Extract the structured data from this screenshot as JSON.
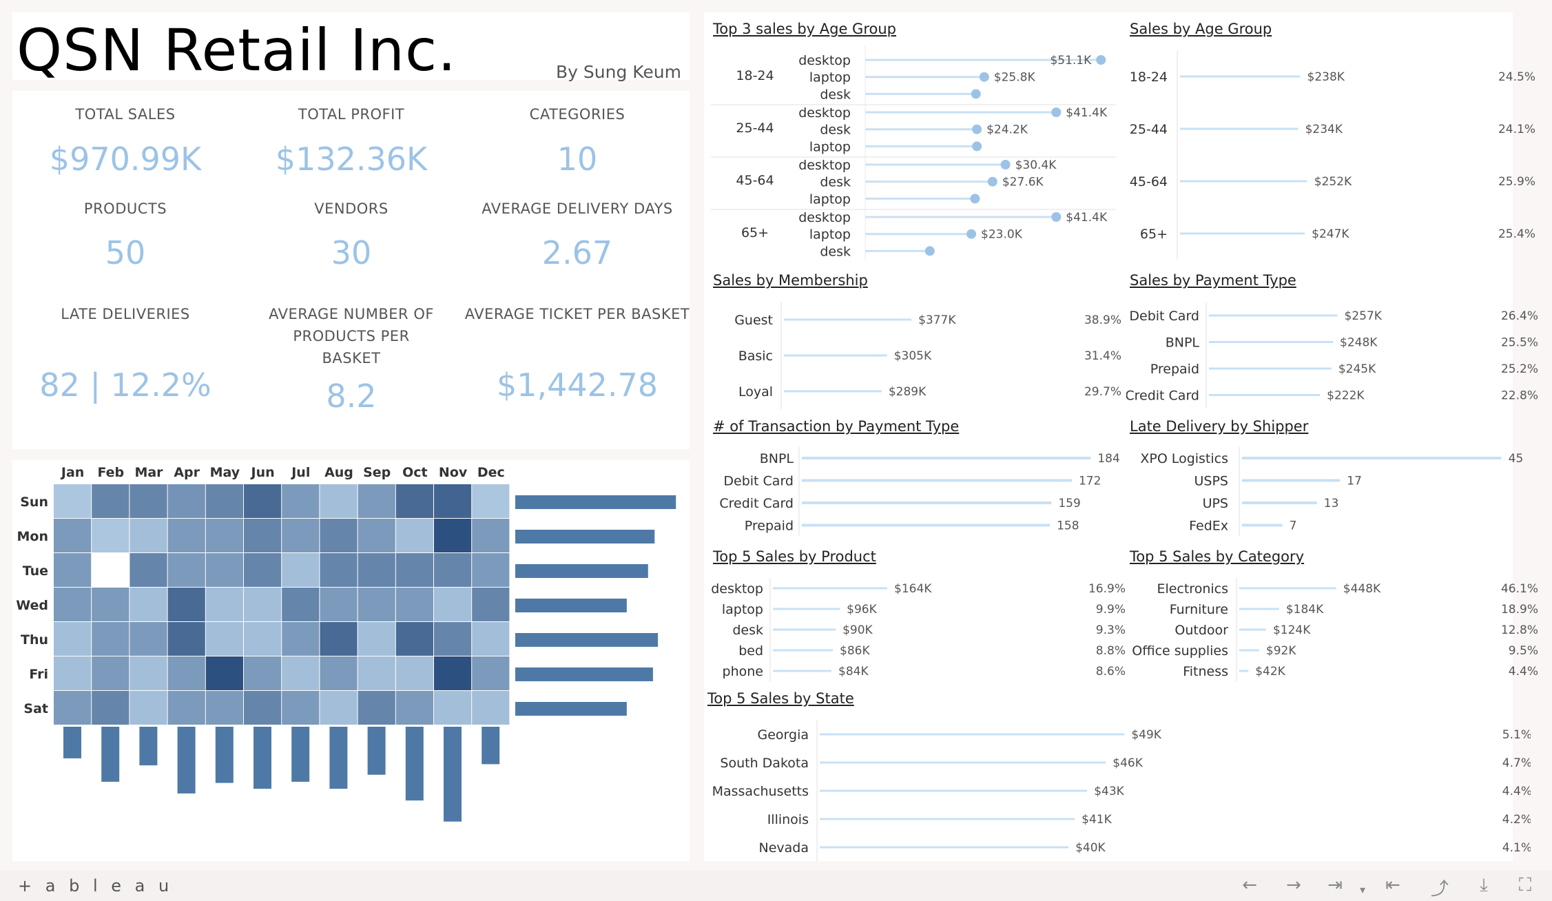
{
  "header": {
    "title": "QSN Retail Inc.",
    "author": "By Sung Keum"
  },
  "kpis": [
    {
      "label": "TOTAL SALES",
      "value": "$970.99K"
    },
    {
      "label": "TOTAL PROFIT",
      "value": "$132.36K"
    },
    {
      "label": "CATEGORIES",
      "value": "10"
    },
    {
      "label": "PRODUCTS",
      "value": "50"
    },
    {
      "label": "VENDORS",
      "value": "30"
    },
    {
      "label": "AVERAGE DELIVERY DAYS",
      "value": "2.67"
    },
    {
      "label": "LATE DELIVERIES",
      "value": "82 | 12.2%"
    },
    {
      "label": "AVERAGE NUMBER OF PRODUCTS PER BASKET",
      "value": "8.2"
    },
    {
      "label": "AVERAGE TICKET PER BASKET",
      "value": "$1,442.78"
    }
  ],
  "colors": {
    "accent": "#9cc3e6",
    "bar_dark": "#4e79a7",
    "bar_light": "#c8e0f4",
    "dot": "#9cc3e6"
  },
  "chart_data": [
    {
      "id": "heatmap",
      "type": "heatmap",
      "months": [
        "Jan",
        "Feb",
        "Mar",
        "Apr",
        "May",
        "Jun",
        "Jul",
        "Aug",
        "Sep",
        "Oct",
        "Nov",
        "Dec"
      ],
      "days": [
        "Sun",
        "Mon",
        "Tue",
        "Wed",
        "Thu",
        "Fri",
        "Sat"
      ],
      "intensity": [
        [
          0.15,
          0.6,
          0.6,
          0.5,
          0.6,
          0.8,
          0.45,
          0.2,
          0.45,
          0.8,
          0.85,
          0.15
        ],
        [
          0.45,
          0.15,
          0.2,
          0.45,
          0.45,
          0.6,
          0.45,
          0.6,
          0.45,
          0.2,
          1.0,
          0.45
        ],
        [
          0.45,
          0.0,
          0.6,
          0.45,
          0.45,
          0.6,
          0.2,
          0.6,
          0.6,
          0.6,
          0.6,
          0.45
        ],
        [
          0.45,
          0.45,
          0.2,
          0.8,
          0.2,
          0.2,
          0.6,
          0.45,
          0.45,
          0.45,
          0.2,
          0.6
        ],
        [
          0.2,
          0.45,
          0.45,
          0.8,
          0.2,
          0.2,
          0.45,
          0.8,
          0.2,
          0.8,
          0.6,
          0.2
        ],
        [
          0.2,
          0.45,
          0.2,
          0.45,
          1.0,
          0.45,
          0.2,
          0.45,
          0.2,
          0.2,
          1.0,
          0.45
        ],
        [
          0.45,
          0.6,
          0.2,
          0.45,
          0.45,
          0.6,
          0.45,
          0.2,
          0.6,
          0.45,
          0.2,
          0.2
        ]
      ],
      "day_totals": [
        0.98,
        0.85,
        0.81,
        0.68,
        0.87,
        0.84,
        0.68
      ],
      "month_totals": [
        0.27,
        0.47,
        0.33,
        0.57,
        0.48,
        0.53,
        0.47,
        0.53,
        0.41,
        0.63,
        0.81,
        0.32
      ]
    },
    {
      "id": "top3-age",
      "type": "scatter",
      "title": "Top 3 sales by Age Group",
      "groups": [
        {
          "name": "18-24",
          "items": [
            {
              "product": "desktop",
              "value": 51.1,
              "label": "$51.1K"
            },
            {
              "product": "laptop",
              "value": 25.8,
              "label": "$25.8K"
            },
            {
              "product": "desk",
              "value": 24.0,
              "label": ""
            }
          ]
        },
        {
          "name": "25-44",
          "items": [
            {
              "product": "desktop",
              "value": 41.4,
              "label": "$41.4K"
            },
            {
              "product": "desk",
              "value": 24.2,
              "label": "$24.2K"
            },
            {
              "product": "laptop",
              "value": 24.2,
              "label": ""
            }
          ]
        },
        {
          "name": "45-64",
          "items": [
            {
              "product": "desktop",
              "value": 30.4,
              "label": "$30.4K"
            },
            {
              "product": "desk",
              "value": 27.6,
              "label": "$27.6K"
            },
            {
              "product": "laptop",
              "value": 23.8,
              "label": ""
            }
          ]
        },
        {
          "name": "65+",
          "items": [
            {
              "product": "desktop",
              "value": 41.4,
              "label": "$41.4K"
            },
            {
              "product": "laptop",
              "value": 23.0,
              "label": "$23.0K"
            },
            {
              "product": "desk",
              "value": 14.0,
              "label": ""
            }
          ]
        }
      ],
      "xlim": [
        0,
        53
      ]
    },
    {
      "id": "age-group",
      "type": "bar",
      "title": "Sales by Age Group",
      "categories": [
        "18-24",
        "25-44",
        "45-64",
        "65+"
      ],
      "values": [
        238,
        234,
        252,
        247
      ],
      "labels": [
        "$238K",
        "$234K",
        "$252K",
        "$247K"
      ],
      "pcts": [
        "24.5%",
        "24.1%",
        "25.9%",
        "25.4%"
      ],
      "xlim": [
        0,
        750
      ]
    },
    {
      "id": "membership",
      "type": "bar",
      "title": "Sales by Membership",
      "categories": [
        "Guest",
        "Basic",
        "Loyal"
      ],
      "values": [
        377,
        305,
        289
      ],
      "labels": [
        "$377K",
        "$305K",
        "$289K"
      ],
      "pcts": [
        "38.9%",
        "31.4%",
        "29.7%"
      ],
      "xlim": [
        0,
        1100
      ]
    },
    {
      "id": "payment-type",
      "type": "bar",
      "title": "Sales by Payment Type",
      "categories": [
        "Debit Card",
        "BNPL",
        "Prepaid",
        "Credit Card"
      ],
      "values": [
        257,
        248,
        245,
        222
      ],
      "labels": [
        "$257K",
        "$248K",
        "$245K",
        "$222K"
      ],
      "pcts": [
        "26.4%",
        "25.5%",
        "25.2%",
        "22.8%"
      ],
      "xlim": [
        0,
        620
      ]
    },
    {
      "id": "transactions",
      "type": "bar",
      "title": "# of Transaction by Payment Type",
      "categories": [
        "BNPL",
        "Debit Card",
        "Credit Card",
        "Prepaid"
      ],
      "values": [
        184,
        172,
        159,
        158
      ],
      "labels": [
        "184",
        "172",
        "159",
        "158"
      ],
      "xlim": [
        0,
        190
      ]
    },
    {
      "id": "late-shipper",
      "type": "bar",
      "title": "Late Delivery by Shipper",
      "categories": [
        "XPO Logistics",
        "USPS",
        "UPS",
        "FedEx"
      ],
      "values": [
        45,
        17,
        13,
        7
      ],
      "labels": [
        "45",
        "17",
        "13",
        "7"
      ],
      "xlim": [
        0,
        46
      ]
    },
    {
      "id": "top5-product",
      "type": "bar",
      "title": "Top 5 Sales by Product",
      "categories": [
        "desktop",
        "laptop",
        "desk",
        "bed",
        "phone"
      ],
      "values": [
        164,
        96,
        90,
        86,
        84
      ],
      "labels": [
        "$164K",
        "$96K",
        "$90K",
        "$86K",
        "$84K"
      ],
      "pcts": [
        "16.9%",
        "9.9%",
        "9.3%",
        "8.8%",
        "8.6%"
      ],
      "xlim": [
        0,
        405
      ]
    },
    {
      "id": "top5-category",
      "type": "bar",
      "title": "Top 5 Sales by Category",
      "categories": [
        "Electronics",
        "Furniture",
        "Outdoor",
        "Office supplies",
        "Fitness"
      ],
      "values": [
        448,
        184,
        124,
        92,
        42
      ],
      "labels": [
        "$448K",
        "$184K",
        "$124K",
        "$92K",
        "$42K"
      ],
      "pcts": [
        "46.1%",
        "18.9%",
        "12.8%",
        "9.5%",
        "4.4%"
      ],
      "xlim": [
        0,
        1050
      ]
    },
    {
      "id": "top5-state",
      "type": "bar",
      "title": "Top 5 Sales by State",
      "categories": [
        "Georgia",
        "South Dakota",
        "Massachusetts",
        "Illinois",
        "Nevada"
      ],
      "values": [
        49,
        46,
        43,
        41,
        40
      ],
      "labels": [
        "$49K",
        "$46K",
        "$43K",
        "$41K",
        "$40K"
      ],
      "pcts": [
        "5.1%",
        "4.7%",
        "4.4%",
        "4.2%",
        "4.1%"
      ],
      "xlim": [
        0,
        72
      ]
    }
  ],
  "footer": {
    "brand": "+ a b l e a u"
  }
}
